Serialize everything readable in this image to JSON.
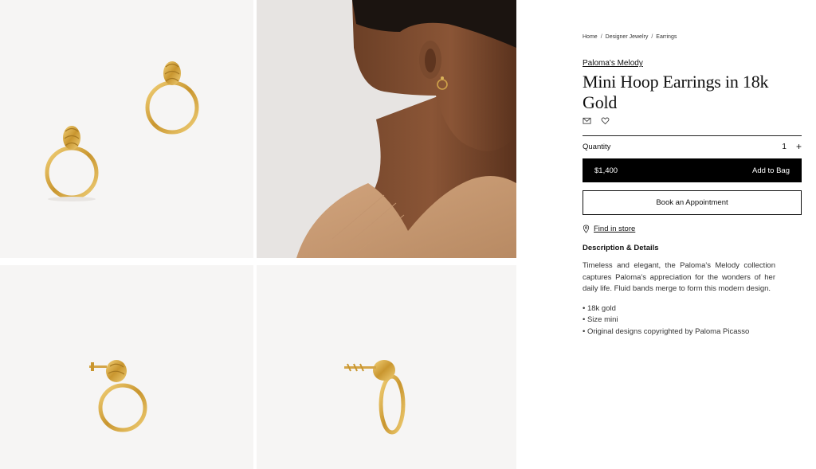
{
  "gallery": {
    "images": [
      {
        "alt": "pair-front"
      },
      {
        "alt": "model-wearing"
      },
      {
        "alt": "earring-side"
      },
      {
        "alt": "earring-profile"
      }
    ]
  },
  "breadcrumb": [
    "Home",
    "Designer Jewelry",
    "Earrings"
  ],
  "breadcrumb_separator": "/",
  "product": {
    "collection": "Paloma's Melody",
    "title": "Mini Hoop Earrings in 18k Gold",
    "quantity_label": "Quantity",
    "quantity_value": "1",
    "quantity_plus": "+",
    "price": "$1,400",
    "add_to_bag": "Add to Bag",
    "book_appointment": "Book an Appointment",
    "find_in_store": "Find in store",
    "description_heading": "Description & Details",
    "description": "Timeless and elegant, the Paloma's Melody collection captures Paloma's appreciation for the wonders of her daily life. Fluid bands merge to form this modern design.",
    "details": [
      "• 18k gold",
      "• Size mini",
      "• Original designs copyrighted by Paloma Picasso"
    ]
  },
  "icons": {
    "mail": "mail-icon",
    "wishlist": "heart-icon",
    "location": "location-pin-icon"
  },
  "colors": {
    "button_bg": "#000000",
    "gold": "#d6a73e",
    "tile_bg": "#f6f5f4"
  }
}
